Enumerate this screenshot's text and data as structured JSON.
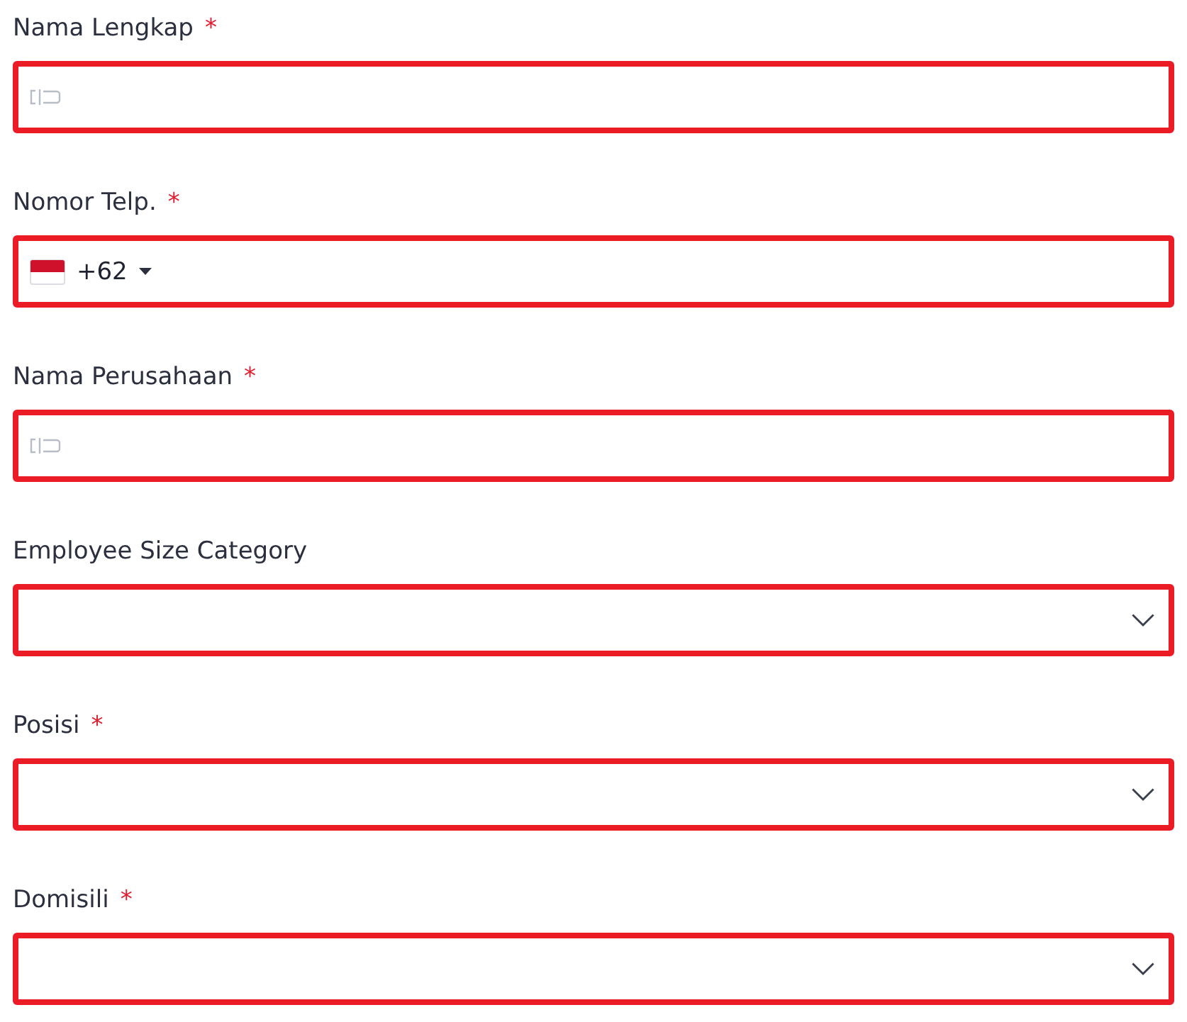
{
  "fields": [
    {
      "kind": "text",
      "label": "Nama Lengkap",
      "required_mark": "*",
      "invalid": true
    },
    {
      "kind": "phone",
      "label": "Nomor Telp.",
      "required_mark": "*",
      "country_code": "+62",
      "invalid": true
    },
    {
      "kind": "text",
      "label": "Nama Perusahaan",
      "required_mark": "*",
      "invalid": true
    },
    {
      "kind": "select",
      "label": "Employee Size Category",
      "invalid": true
    },
    {
      "kind": "select",
      "label": "Posisi",
      "required_mark": "*",
      "invalid": true
    },
    {
      "kind": "select",
      "label": "Domisili",
      "required_mark": "*",
      "invalid": true
    }
  ]
}
